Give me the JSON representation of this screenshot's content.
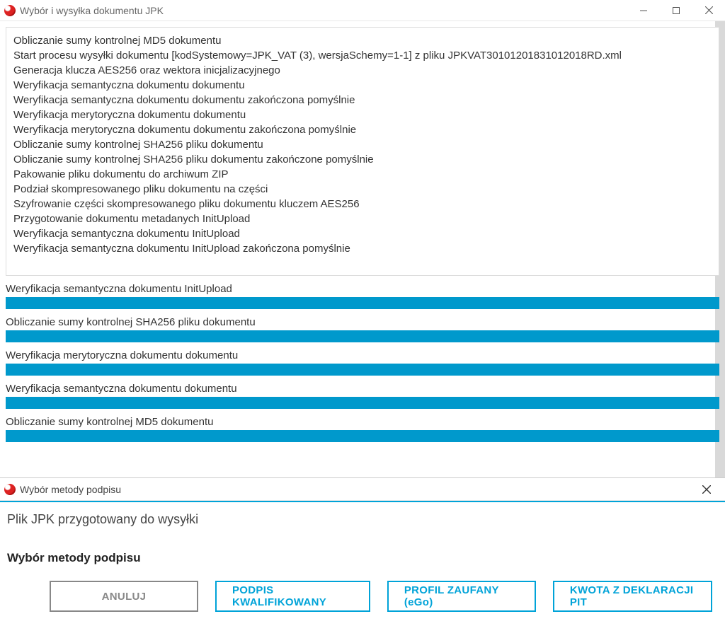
{
  "window": {
    "title": "Wybór i wysyłka dokumentu JPK"
  },
  "log": {
    "lines": [
      "Obliczanie sumy kontrolnej MD5 dokumentu",
      "Start procesu wysyłki dokumentu [kodSystemowy=JPK_VAT (3), wersjaSchemy=1-1] z pliku JPKVAT30101201831012018RD.xml",
      "Generacja klucza AES256 oraz wektora inicjalizacyjnego",
      "Weryfikacja semantyczna dokumentu dokumentu",
      "Weryfikacja semantyczna dokumentu dokumentu zakończona pomyślnie",
      "Weryfikacja merytoryczna dokumentu dokumentu",
      "Weryfikacja merytoryczna dokumentu dokumentu zakończona pomyślnie",
      "Obliczanie sumy kontrolnej SHA256 pliku dokumentu",
      "Obliczanie sumy kontrolnej SHA256 pliku dokumentu zakończone pomyślnie",
      "Pakowanie pliku dokumentu do archiwum ZIP",
      "Podział skompresowanego pliku dokumentu na części",
      "Szyfrowanie części skompresowanego pliku dokumentu kluczem AES256",
      "Przygotowanie dokumentu metadanych InitUpload",
      "Weryfikacja semantyczna dokumentu InitUpload",
      "Weryfikacja semantyczna dokumentu InitUpload zakończona pomyślnie"
    ]
  },
  "progress": {
    "items": [
      {
        "label": "Weryfikacja semantyczna dokumentu InitUpload",
        "percent": 100
      },
      {
        "label": "Obliczanie sumy kontrolnej SHA256 pliku dokumentu",
        "percent": 100
      },
      {
        "label": "Weryfikacja merytoryczna dokumentu dokumentu",
        "percent": 100
      },
      {
        "label": "Weryfikacja semantyczna dokumentu dokumentu",
        "percent": 100
      },
      {
        "label": "Obliczanie sumy kontrolnej MD5 dokumentu",
        "percent": 100
      }
    ]
  },
  "modal": {
    "title": "Wybór metody podpisu",
    "subtitle": "Plik JPK przygotowany do wysyłki",
    "heading": "Wybór metody podpisu",
    "buttons": {
      "cancel": "ANULUJ",
      "qualified": "PODPIS KWALIFIKOWANY",
      "trusted": "PROFIL ZAUFANY (eGo)",
      "pit": "KWOTA Z DEKLARACJI PIT"
    }
  }
}
